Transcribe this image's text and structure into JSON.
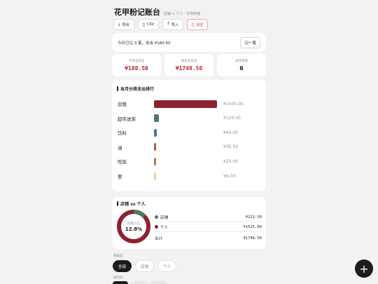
{
  "header": {
    "title": "花甲粉记账台",
    "subtitle": "店铺 + 个人 · 本地存储"
  },
  "toolbar": [
    {
      "icon": "download-icon",
      "glyph": "⤓",
      "label": "导出"
    },
    {
      "icon": "file-icon",
      "glyph": "▯",
      "label": "CSV"
    },
    {
      "icon": "upload-icon",
      "glyph": "⤒",
      "label": "导入"
    },
    {
      "icon": "trash-icon",
      "glyph": "▯",
      "label": "清空"
    }
  ],
  "summary": {
    "text": "今日已记 3 笔，支出 ¥180.50",
    "button": "记一笔"
  },
  "stats": [
    {
      "label": "今日总支出",
      "value": "¥180.50"
    },
    {
      "label": "本月总支出",
      "value": "¥1748.50"
    },
    {
      "label": "本月笔数",
      "value": "6"
    }
  ],
  "ranking": {
    "title": "本月分类支出排行",
    "items": [
      {
        "name": "房租",
        "amount": 1500.0,
        "label": "¥1500.00",
        "color": "#8b2232"
      },
      {
        "name": "超市送菜",
        "amount": 120.0,
        "label": "¥120.00",
        "color": "#4e7a5c"
      },
      {
        "name": "饮料",
        "amount": 60.0,
        "label": "¥60.00",
        "color": "#4f6f94"
      },
      {
        "name": "油",
        "amount": 35.5,
        "label": "¥35.50",
        "color": "#a4643c"
      },
      {
        "name": "吃饭",
        "amount": 25.0,
        "label": "¥25.00",
        "color": "#b77a50"
      },
      {
        "name": "葱",
        "amount": 8.0,
        "label": "¥8.00",
        "color": "#e7d39c"
      }
    ]
  },
  "split": {
    "title": "店铺 vs 个人",
    "center_label": "店铺占比",
    "center_value": "12.8%",
    "shop_fraction": 0.128,
    "rows": [
      {
        "name": "店铺",
        "amount": "¥223.50",
        "color": "#4e7a5c"
      },
      {
        "name": "个人",
        "amount": "¥1525.00",
        "color": "#8b2232"
      }
    ],
    "total_label": "合计",
    "total_amount": "¥1748.50"
  },
  "filters": {
    "type_label": "按类型",
    "type_chips": [
      "全部",
      "店铺",
      "个人"
    ],
    "time_label": "按时间"
  },
  "fab": {
    "label": "+"
  }
}
